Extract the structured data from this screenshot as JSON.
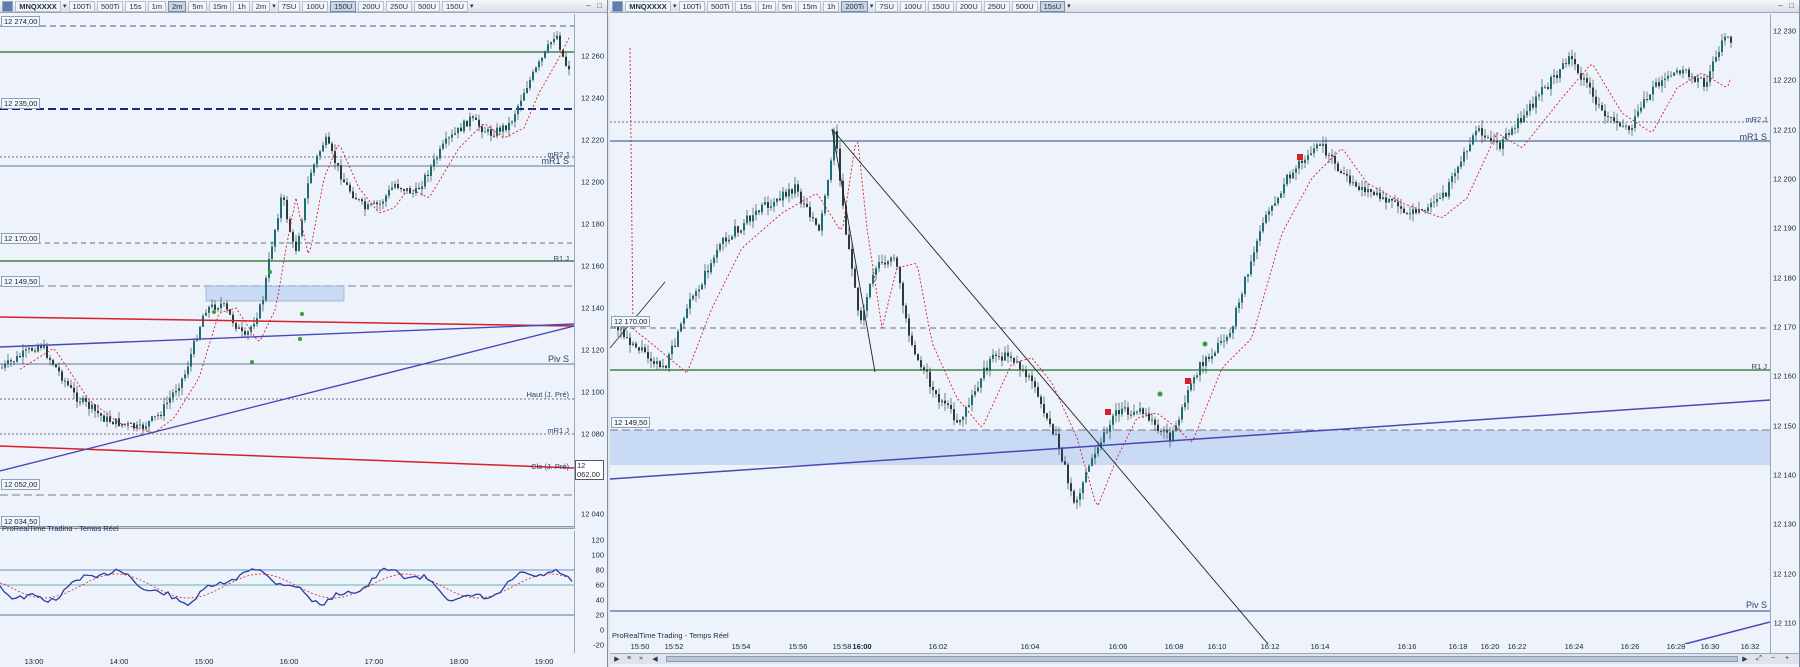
{
  "left": {
    "toolbar": {
      "symbol": "MNQXXXX",
      "buttons": [
        "100Ti",
        "500Ti",
        "15s",
        "1m",
        "2m",
        "2m",
        "5m",
        "15m",
        "1h"
      ],
      "selected_timeframe": "2m",
      "volume_buttons": [
        "7SU",
        "100U",
        "150U",
        "200U",
        "250U",
        "500U",
        "150U"
      ],
      "selected_volume": "150U"
    },
    "y_ticks": [
      "12 260",
      "12 240",
      "12 220",
      "12 200",
      "12 180",
      "12 160",
      "12 140",
      "12 120",
      "12 100",
      "12 080",
      "12 062,00",
      "12 040"
    ],
    "box_labels": [
      "12 274,00",
      "12 235,00",
      "12 170,00",
      "12 149,50",
      "12 052,00",
      "12 034,50"
    ],
    "level_labels": {
      "mr2": "mR2 J",
      "mr1": "mR1 S",
      "r1": "R1 J",
      "piv": "Piv S",
      "haut": "Haut (J. Pré)",
      "mr1j": "mR1 J",
      "clo": "Clo (J. Pré)"
    },
    "source": "ProRealTime Trading - Temps Réel",
    "osc_ticks": [
      "120",
      "100",
      "80",
      "60",
      "40",
      "20",
      "0",
      "-20"
    ],
    "x_ticks": [
      "13:00",
      "14:00",
      "15:00",
      "16:00",
      "17:00",
      "18:00",
      "19:00"
    ]
  },
  "right": {
    "toolbar": {
      "symbol": "MNQXXXX",
      "buttons": [
        "100Ti",
        "500Ti",
        "15s",
        "1m",
        "5m",
        "15m",
        "1h",
        "200Ti"
      ],
      "selected_timeframe": "200Ti",
      "volume_buttons": [
        "7SU",
        "100U",
        "150U",
        "200U",
        "250U",
        "500U",
        "15sU"
      ],
      "selected_volume": "15sU"
    },
    "y_ticks": [
      "12 230",
      "12 220",
      "12 210",
      "12 200",
      "12 190",
      "12 180",
      "12 170",
      "12 160",
      "12 150",
      "12 140",
      "12 130",
      "12 120",
      "12 110"
    ],
    "box_labels": [
      "12 170,00",
      "12 149,50"
    ],
    "level_labels": {
      "mr2": "mR2 J",
      "mr1": "mR1 S",
      "r1": "R1 J",
      "piv": "Piv S"
    },
    "source": "ProRealTime Trading - Temps Réel",
    "x_ticks": [
      "15:50",
      "15:52",
      "15:54",
      "15:56",
      "15:58",
      "16:00",
      "16:02",
      "16:04",
      "16:06",
      "16:08",
      "16:10",
      "16:12",
      "16:14",
      "16:16",
      "16:18",
      "16:20",
      "16:22",
      "16:24",
      "16:26",
      "16:28",
      "16:30",
      "16:32"
    ]
  },
  "colors": {
    "bull": "#1d6e73",
    "bear": "#2b3a3a",
    "level_green": "#1f6b2c",
    "level_navy": "#1b2a78",
    "red": "#d81e28",
    "purple": "#4b48b5",
    "zone": "#c9daf4"
  }
}
